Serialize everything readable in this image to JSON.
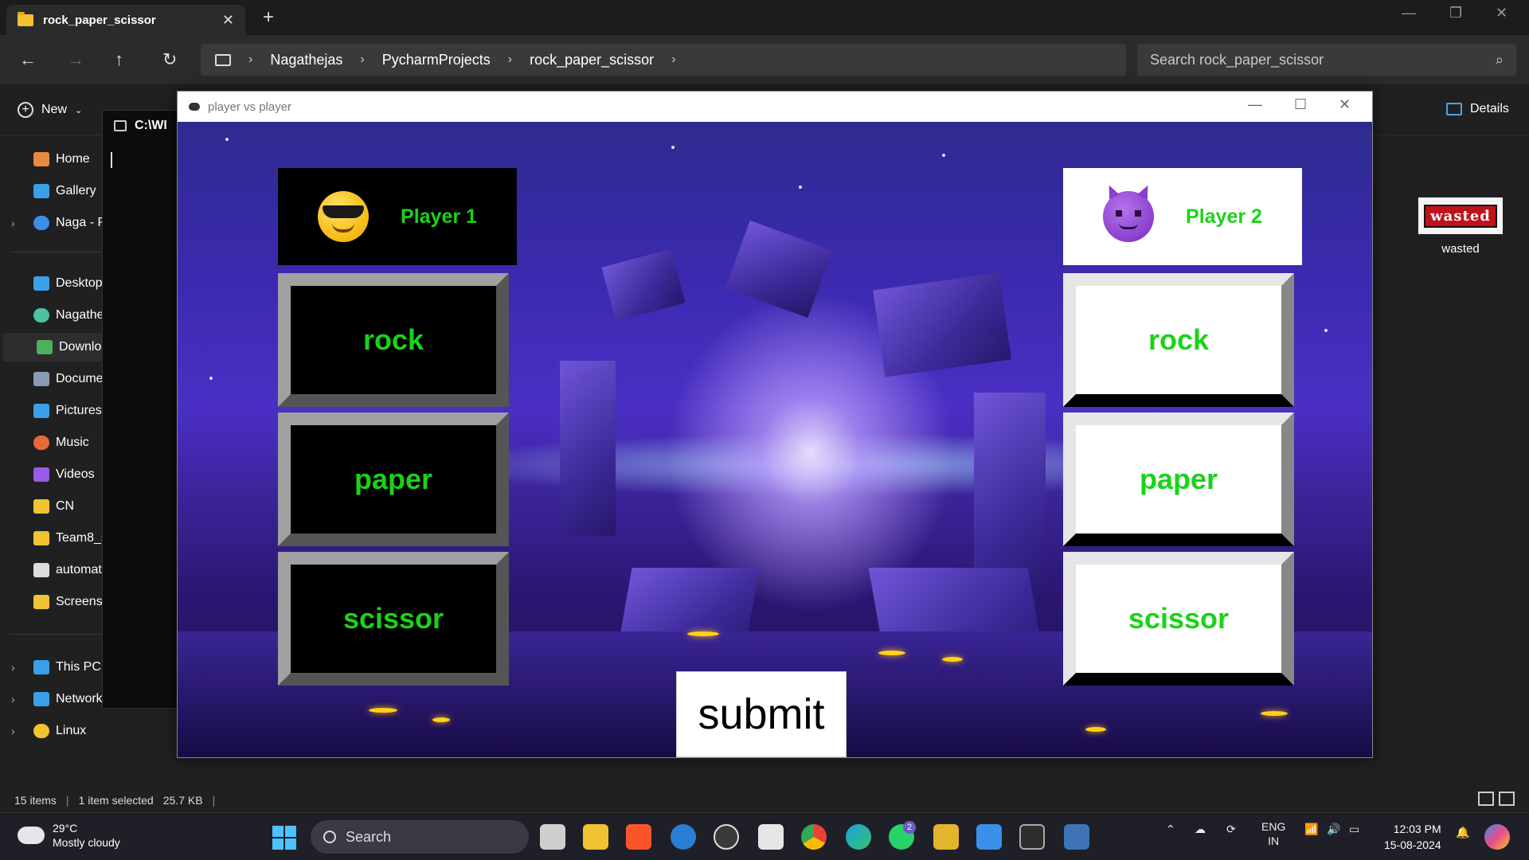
{
  "explorer": {
    "tab_title": "rock_paper_scissor",
    "breadcrumb": [
      "Nagathejas",
      "PycharmProjects",
      "rock_paper_scissor"
    ],
    "search_placeholder": "Search rock_paper_scissor",
    "new_label": "New",
    "details_label": "Details",
    "sidebar": [
      {
        "label": "Home",
        "color": "#e98b3a"
      },
      {
        "label": "Gallery",
        "color": "#3aa0e9"
      },
      {
        "label": "Naga - Pe",
        "color": "#3a8fe9"
      },
      {
        "label": "Desktop",
        "color": "#3aa0e9"
      },
      {
        "label": "Nagathej",
        "color": "#4cc2a0"
      },
      {
        "label": "Downloa",
        "color": "#4cb05c"
      },
      {
        "label": "Documer",
        "color": "#8a9ab0"
      },
      {
        "label": "Pictures",
        "color": "#3aa0e9"
      },
      {
        "label": "Music",
        "color": "#e9683a"
      },
      {
        "label": "Videos",
        "color": "#9b5ae9"
      },
      {
        "label": "CN",
        "color": "#f1c232"
      },
      {
        "label": "Team8_su",
        "color": "#f1c232"
      },
      {
        "label": "automata",
        "color": "#dddddd"
      },
      {
        "label": "Screensho",
        "color": "#f1c232"
      },
      {
        "label": "This PC",
        "color": "#3aa0e9"
      },
      {
        "label": "Network",
        "color": "#3aa0e9"
      },
      {
        "label": "Linux",
        "color": "#f1c232"
      }
    ],
    "status": {
      "items": "15 items",
      "selected": "1 item selected",
      "size": "25.7 KB"
    }
  },
  "terminal": {
    "title": "C:\\WI"
  },
  "desktop_icon": {
    "badge": "wasted",
    "label": "wasted"
  },
  "game": {
    "window_title": "player vs player",
    "player1": {
      "name": "Player 1",
      "choices": [
        "rock",
        "paper",
        "scissor"
      ]
    },
    "player2": {
      "name": "Player 2",
      "choices": [
        "rock",
        "paper",
        "scissor"
      ]
    },
    "submit_label": "submit",
    "accent_color": "#19d319"
  },
  "taskbar": {
    "weather_temp": "29°C",
    "weather_desc": "Mostly cloudy",
    "search_label": "Search",
    "lang_1": "ENG",
    "lang_2": "IN",
    "time": "12:03 PM",
    "date": "15-08-2024",
    "whatsapp_badge": "2"
  }
}
